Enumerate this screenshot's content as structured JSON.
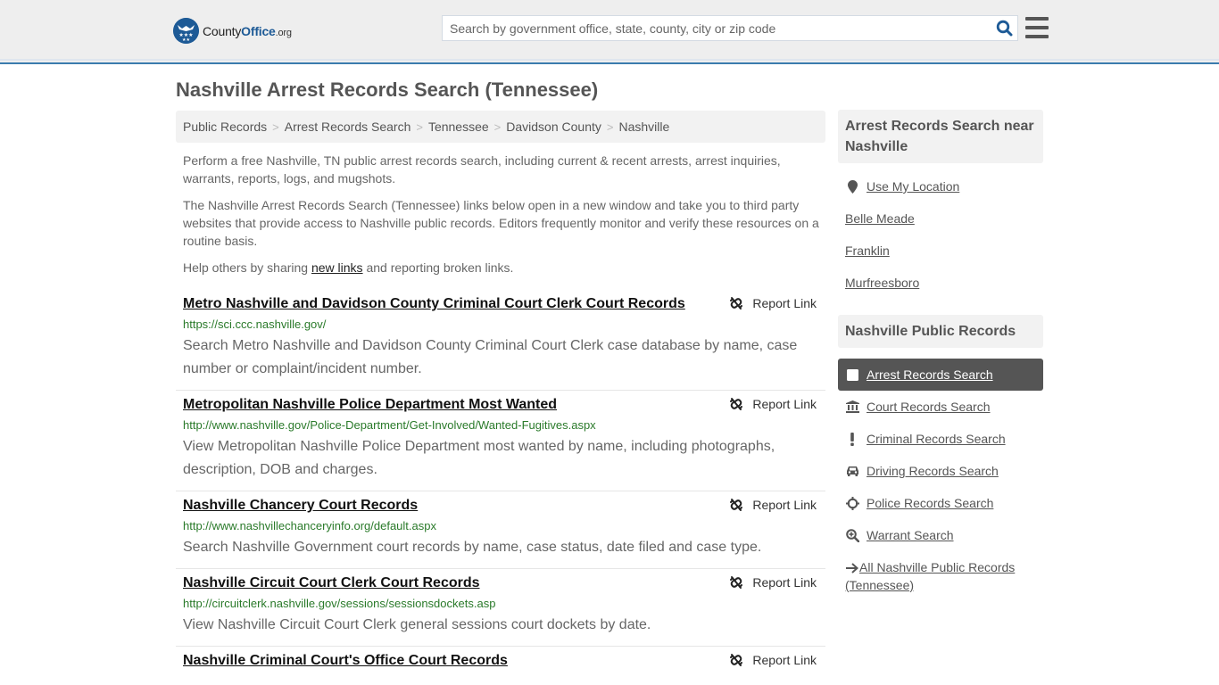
{
  "header": {
    "logo": {
      "brand_main": "County",
      "brand_accent": "Office",
      "brand_tld": ".org"
    },
    "search": {
      "placeholder": "Search by government office, state, county, city or zip code",
      "value": ""
    },
    "icons": {
      "search": "search-icon",
      "menu": "hamburger-menu-icon"
    }
  },
  "page": {
    "title": "Nashville Arrest Records Search (Tennessee)",
    "breadcrumb": [
      "Public Records",
      "Arrest Records Search",
      "Tennessee",
      "Davidson County",
      "Nashville"
    ],
    "intro": {
      "p1": "Perform a free Nashville, TN public arrest records search, including current & recent arrests, arrest inquiries, warrants, reports, logs, and mugshots.",
      "p2": "The Nashville Arrest Records Search (Tennessee) links below open in a new window and take you to third party websites that provide access to Nashville public records. Editors frequently monitor and verify these resources on a routine basis.",
      "p3_before": "Help others by sharing ",
      "p3_link": "new links",
      "p3_after": " and reporting broken links."
    }
  },
  "results": [
    {
      "title": "Metro Nashville and Davidson County Criminal Court Clerk Court Records",
      "url": "https://sci.ccc.nashville.gov/",
      "description": "Search Metro Nashville and Davidson County Criminal Court Clerk case database by name, case number or complaint/incident number.",
      "report_label": "Report Link"
    },
    {
      "title": "Metropolitan Nashville Police Department Most Wanted",
      "url": "http://www.nashville.gov/Police-Department/Get-Involved/Wanted-Fugitives.aspx",
      "description": "View Metropolitan Nashville Police Department most wanted by name, including photographs, description, DOB and charges.",
      "report_label": "Report Link"
    },
    {
      "title": "Nashville Chancery Court Records",
      "url": "http://www.nashvillechanceryinfo.org/default.aspx",
      "description": "Search Nashville Government court records by name, case status, date filed and case type.",
      "report_label": "Report Link"
    },
    {
      "title": "Nashville Circuit Court Clerk Court Records",
      "url": "http://circuitclerk.nashville.gov/sessions/sessionsdockets.asp",
      "description": "View Nashville Circuit Court Clerk general sessions court dockets by date.",
      "report_label": "Report Link"
    },
    {
      "title": "Nashville Criminal Court's Office Court Records",
      "url": "",
      "description": "",
      "report_label": "Report Link"
    }
  ],
  "sidebar": {
    "nearby": {
      "heading": "Arrest Records Search near Nashville",
      "use_location": "Use My Location",
      "places": [
        "Belle Meade",
        "Franklin",
        "Murfreesboro"
      ]
    },
    "public_records": {
      "heading": "Nashville Public Records",
      "items": [
        {
          "label": "Arrest Records Search",
          "icon": "square-icon",
          "active": true
        },
        {
          "label": "Court Records Search",
          "icon": "courthouse-icon",
          "active": false
        },
        {
          "label": "Criminal Records Search",
          "icon": "exclamation-icon",
          "active": false
        },
        {
          "label": "Driving Records Search",
          "icon": "car-icon",
          "active": false
        },
        {
          "label": "Police Records Search",
          "icon": "crosshair-icon",
          "active": false
        },
        {
          "label": "Warrant Search",
          "icon": "zoom-in-icon",
          "active": false
        }
      ],
      "all_link": "All Nashville Public Records (Tennessee)"
    }
  },
  "colors": {
    "header_bg": "#eeeeee",
    "header_border": "#3a7bad",
    "brand_blue": "#1d5a96",
    "url_green": "#2a7a2a",
    "active_item_bg": "#555555"
  }
}
